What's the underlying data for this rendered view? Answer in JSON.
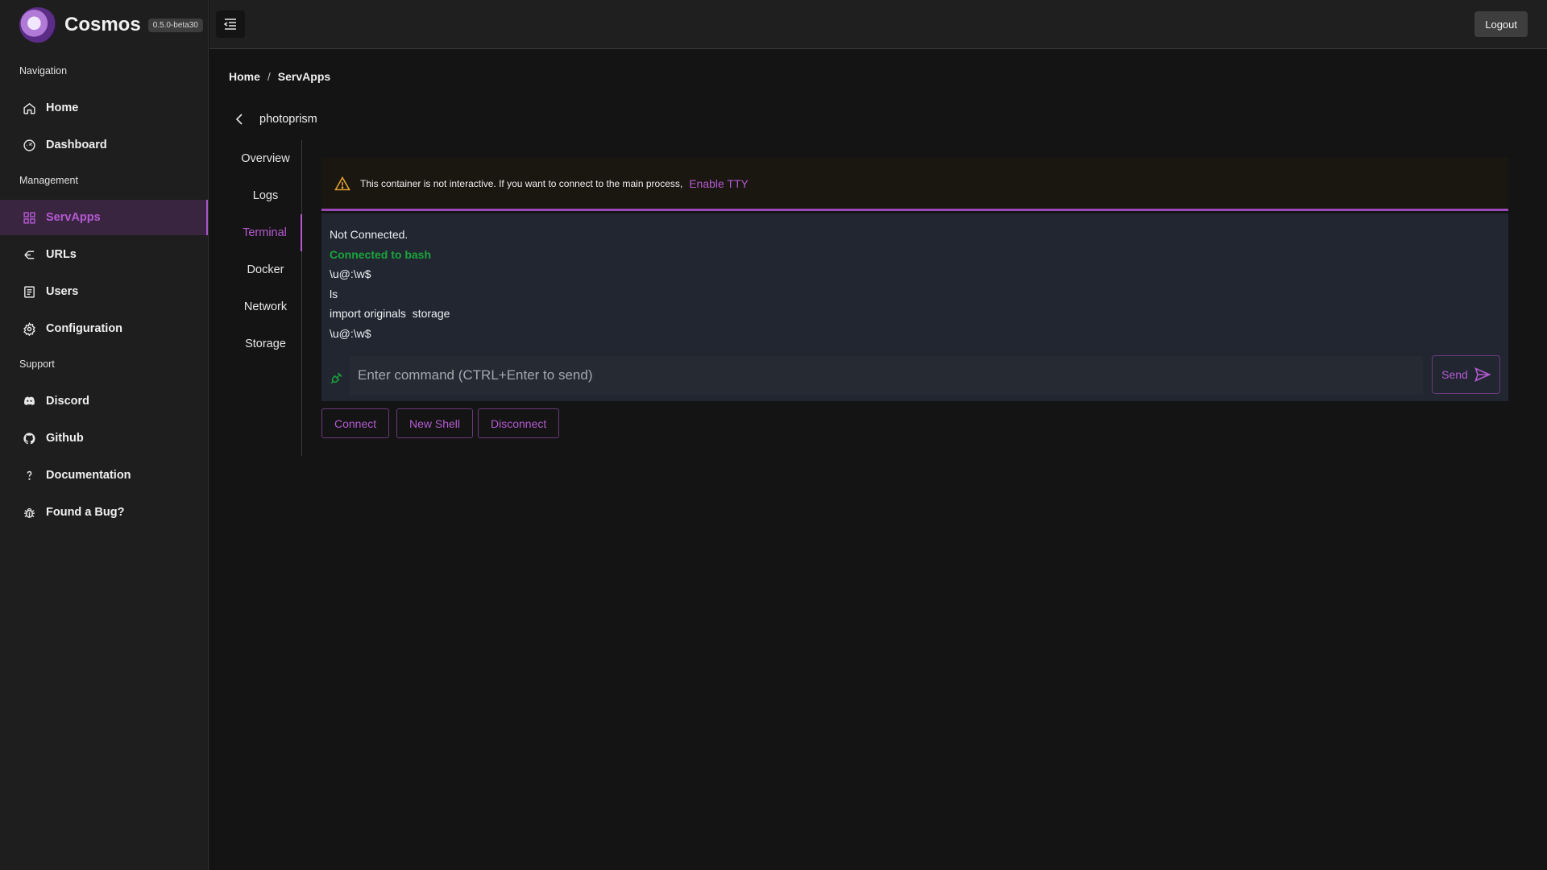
{
  "app": {
    "name": "Cosmos",
    "version": "0.5.0-beta30"
  },
  "sidebar": {
    "sections": [
      {
        "title": "Navigation"
      },
      {
        "title": "Management"
      },
      {
        "title": "Support"
      }
    ],
    "items": [
      {
        "label": "Home",
        "icon": "home-icon"
      },
      {
        "label": "Dashboard",
        "icon": "dashboard-icon"
      },
      {
        "label": "ServApps",
        "icon": "grid-icon",
        "active": true
      },
      {
        "label": "URLs",
        "icon": "urls-icon"
      },
      {
        "label": "Users",
        "icon": "users-icon"
      },
      {
        "label": "Configuration",
        "icon": "gear-icon"
      },
      {
        "label": "Discord",
        "icon": "discord-icon"
      },
      {
        "label": "Github",
        "icon": "github-icon"
      },
      {
        "label": "Documentation",
        "icon": "question-icon"
      },
      {
        "label": "Found a Bug?",
        "icon": "bug-icon"
      }
    ]
  },
  "topbar": {
    "logout_label": "Logout"
  },
  "breadcrumb": {
    "home": "Home",
    "separator": "/",
    "current": "ServApps"
  },
  "container": {
    "name": "photoprism"
  },
  "tabs": [
    {
      "label": "Overview"
    },
    {
      "label": "Logs"
    },
    {
      "label": "Terminal",
      "active": true
    },
    {
      "label": "Docker"
    },
    {
      "label": "Network"
    },
    {
      "label": "Storage"
    }
  ],
  "alert": {
    "text": "This container is not interactive. If you want to connect to the main process,",
    "link": "Enable TTY"
  },
  "terminal": {
    "lines": [
      {
        "text": "Not Connected."
      },
      {
        "text": "Connected to bash",
        "status": "ok"
      },
      {
        "text": "\\u@:\\w$"
      },
      {
        "text": "ls"
      },
      {
        "text": "import originals  storage"
      },
      {
        "text": "\\u@:\\w$"
      }
    ],
    "input_placeholder": "Enter command (CTRL+Enter to send)",
    "send_label": "Send"
  },
  "actions": {
    "connect": "Connect",
    "new_shell": "New Shell",
    "disconnect": "Disconnect"
  },
  "colors": {
    "accent": "#b45ad1",
    "success": "#1aa53a",
    "warning": "#e0a030"
  }
}
